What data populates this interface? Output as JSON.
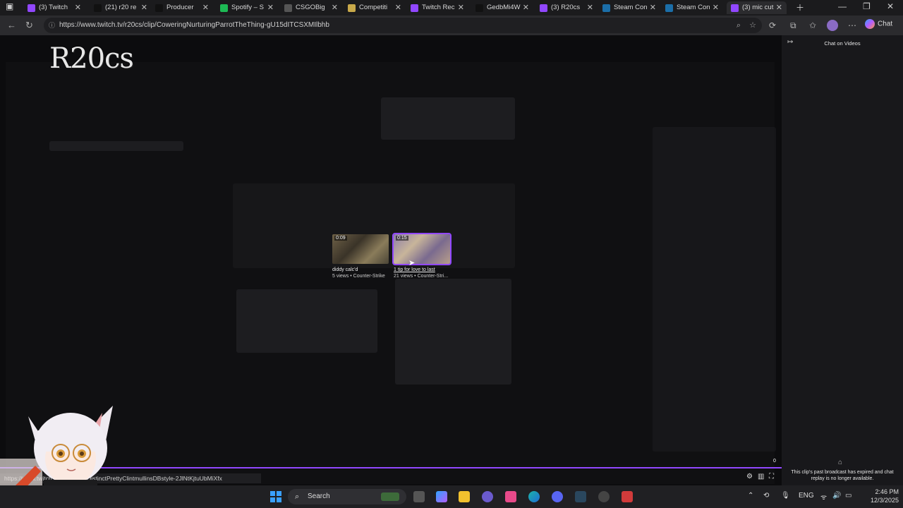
{
  "browser": {
    "tabs": [
      {
        "label": "(3) Twitch",
        "favicon_color": "#9147ff"
      },
      {
        "label": "(21) r20 re",
        "favicon_color": "#111111"
      },
      {
        "label": "Producer",
        "favicon_color": "#111111"
      },
      {
        "label": "Spotify – S",
        "favicon_color": "#1db954"
      },
      {
        "label": "CSGOBig",
        "favicon_color": "#555555"
      },
      {
        "label": "Competiti",
        "favicon_color": "#c8a94a"
      },
      {
        "label": "Twitch Rec",
        "favicon_color": "#9147ff"
      },
      {
        "label": "GedbMi4W",
        "favicon_color": "#111111"
      },
      {
        "label": "(3) R20cs",
        "favicon_color": "#9147ff"
      },
      {
        "label": "Steam Con",
        "favicon_color": "#1b6ea8"
      },
      {
        "label": "Steam Con",
        "favicon_color": "#1b6ea8"
      },
      {
        "label": "(3) mic cut",
        "favicon_color": "#9147ff"
      }
    ],
    "url": "https://www.twitch.tv/r20cs/clip/CoweringNurturingParrotTheThing-gU15dITCSXMIlbhb",
    "chat_button_label": "Chat",
    "status_url": "https://www.twitch.tv/r20cs/clip/DistinctPrettyClintmullinsDBstyle-2JlNtKjtuUbMiXfx"
  },
  "overlay": {
    "watermark": "R20cs"
  },
  "player": {
    "clips": [
      {
        "duration": "0:09",
        "title": "diddy calc'd",
        "meta": "5 views • Counter-Strike",
        "selected": false
      },
      {
        "duration": "0:15",
        "title": "1 tip for love to last",
        "meta": "21 views • Counter-Stri...",
        "selected": true
      }
    ],
    "view_count": "0",
    "accent_color": "#9147ff"
  },
  "chat_panel": {
    "title": "Chat on Videos",
    "expired_message": "This clip's past broadcast has expired and chat replay is no longer available."
  },
  "taskbar": {
    "search_label": "Search",
    "language": "ENG",
    "time": "2:46 PM",
    "date": "12/3/2025"
  }
}
